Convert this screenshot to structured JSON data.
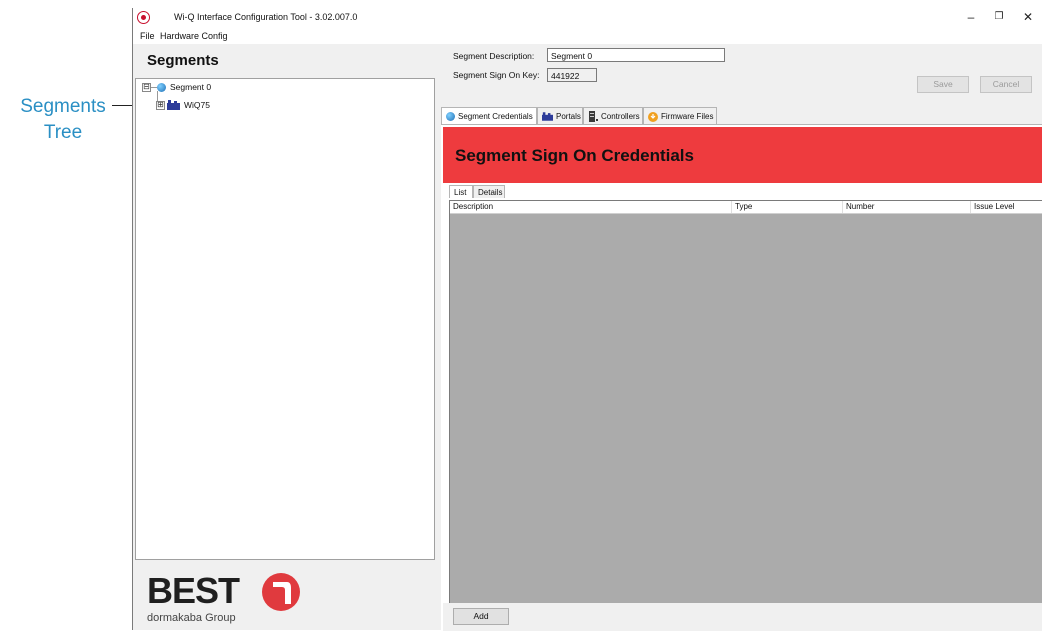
{
  "callout": {
    "line1": "Segments",
    "line2": "Tree"
  },
  "window": {
    "title": "Wi-Q Interface Configuration Tool - 3.02.007.0",
    "controls": {
      "minimize": "–",
      "restore": "❐",
      "close": "✕"
    }
  },
  "menu": {
    "items": [
      "File",
      "Hardware Config"
    ]
  },
  "left": {
    "title": "Segments",
    "tree": [
      {
        "label": "Segment 0",
        "icon": "globe-icon",
        "expander": "⊟"
      },
      {
        "label": "WiQ75",
        "icon": "factory-icon",
        "expander": "⊞"
      }
    ]
  },
  "logo": {
    "brand": "BEST",
    "tagline": "dormakaba Group"
  },
  "form": {
    "desc_label": "Segment Description:",
    "desc_value": "Segment 0",
    "key_label": "Segment Sign On Key:",
    "key_value": "441922",
    "save": "Save",
    "cancel": "Cancel"
  },
  "tabs": [
    {
      "label": "Segment Credentials",
      "icon": "globe-icon"
    },
    {
      "label": "Portals",
      "icon": "factory-icon"
    },
    {
      "label": "Controllers",
      "icon": "controller-icon"
    },
    {
      "label": "Firmware Files",
      "icon": "firmware-icon"
    }
  ],
  "banner": {
    "title": "Segment Sign On Credentials"
  },
  "subtabs": [
    "List",
    "Details"
  ],
  "grid": {
    "columns": [
      "Description",
      "Type",
      "Number",
      "Issue Level"
    ]
  },
  "add_button": "Add",
  "colors": {
    "banner": "#ee3b3e",
    "accent": "#2a8fc4",
    "logo_red": "#c8102e"
  }
}
